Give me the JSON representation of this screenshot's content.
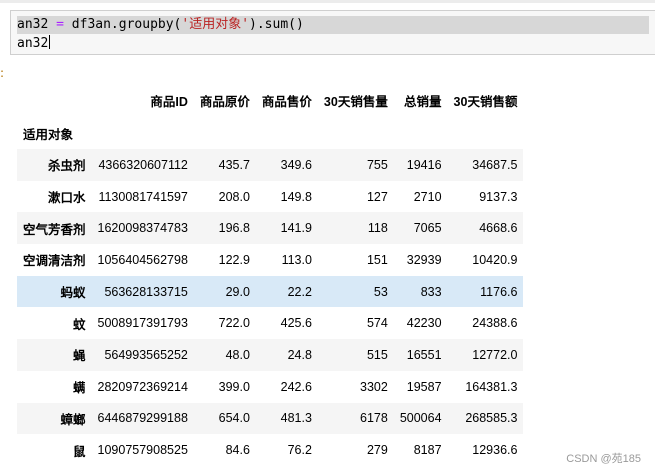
{
  "code": {
    "line1_var": "an32",
    "line1_op": "=",
    "line1_mid": "df3an.groupby(",
    "line1_str": "'适用对象'",
    "line1_end": ").sum()",
    "line2": "an32"
  },
  "table": {
    "index_name": "适用对象",
    "columns": [
      "商品ID",
      "商品原价",
      "商品售价",
      "30天销售量",
      "总销量",
      "30天销售额"
    ],
    "highlighted_row": 4,
    "rows": [
      {
        "index": "杀虫剂",
        "values": [
          "4366320607112",
          "435.7",
          "349.6",
          "755",
          "19416",
          "34687.5"
        ]
      },
      {
        "index": "漱口水",
        "values": [
          "1130081741597",
          "208.0",
          "149.8",
          "127",
          "2710",
          "9137.3"
        ]
      },
      {
        "index": "空气芳香剂",
        "values": [
          "1620098374783",
          "196.8",
          "141.9",
          "118",
          "7065",
          "4668.6"
        ]
      },
      {
        "index": "空调清洁剂",
        "values": [
          "1056404562798",
          "122.9",
          "113.0",
          "151",
          "32939",
          "10420.9"
        ]
      },
      {
        "index": "蚂蚁",
        "values": [
          "563628133715",
          "29.0",
          "22.2",
          "53",
          "833",
          "1176.6"
        ]
      },
      {
        "index": "蚊",
        "values": [
          "5008917391793",
          "722.0",
          "425.6",
          "574",
          "42230",
          "24388.6"
        ]
      },
      {
        "index": "蝇",
        "values": [
          "564993565252",
          "48.0",
          "24.8",
          "515",
          "16551",
          "12772.0"
        ]
      },
      {
        "index": "螨",
        "values": [
          "2820972369214",
          "399.0",
          "242.6",
          "3302",
          "19587",
          "164381.3"
        ]
      },
      {
        "index": "蟑螂",
        "values": [
          "6446879299188",
          "654.0",
          "481.3",
          "6178",
          "500064",
          "268585.3"
        ]
      },
      {
        "index": "鼠",
        "values": [
          "1090757908525",
          "84.6",
          "76.2",
          "279",
          "8187",
          "12936.6"
        ]
      }
    ]
  },
  "watermark": "CSDN @苑185"
}
